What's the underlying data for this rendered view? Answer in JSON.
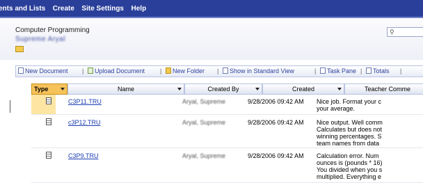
{
  "topnav": {
    "items": [
      "ents and Lists",
      "Create",
      "Site Settings",
      "Help"
    ]
  },
  "header": {
    "site_title": "Computer Programming",
    "user_name": "Supreme Aryal"
  },
  "toolbar": {
    "new_document": "New Document",
    "upload_document": "Upload Document",
    "new_folder": "New Folder",
    "standard_view": "Show in Standard View",
    "task_pane": "Task Pane",
    "totals": "Totals",
    "separator": "|"
  },
  "grid": {
    "columns": [
      "Type",
      "Name",
      "Created By",
      "Created",
      "Teacher Comme"
    ],
    "rows": [
      {
        "name": "C3P11.TRU",
        "created_by": "Aryal, Supreme",
        "created": "9/28/2006 09:42 AM",
        "comment": "Nice job. Format your c\nyour average."
      },
      {
        "name": "c3P12.TRU",
        "created_by": "Aryal, Supreme",
        "created": "9/28/2006 09:42 AM",
        "comment": "Nice output. Well comm\nCalculates but does not\nwinning percentages. S\nteam names from data"
      },
      {
        "name": "C3P9.TRU",
        "created_by": "Aryal, Supreme",
        "created": "9/28/2006 09:42 AM",
        "comment": "Calculation error. Num\nounces is (pounds * 16)\nYou divided when you s\nmultiplied. Everything e"
      }
    ]
  }
}
